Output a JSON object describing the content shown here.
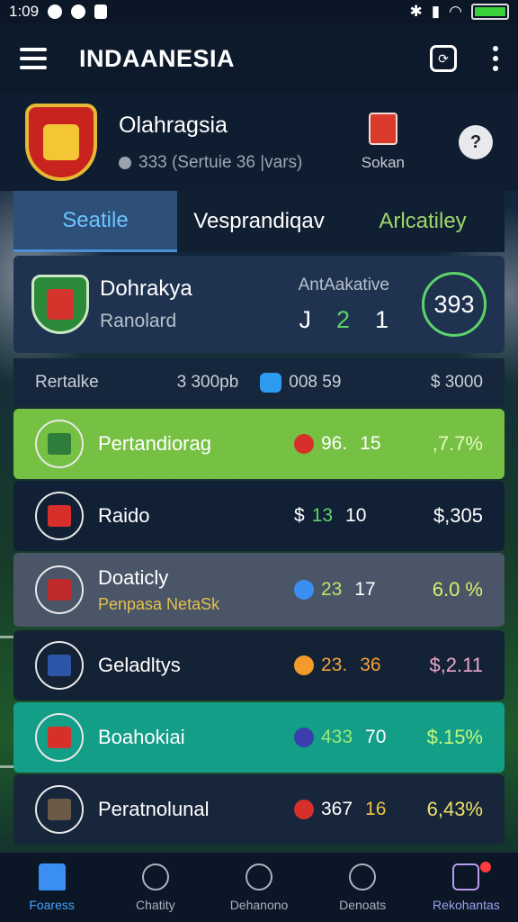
{
  "status_bar": {
    "time": "1:09",
    "icons": [
      "record-icon",
      "g-icon",
      "notification-icon",
      "bluetooth-icon",
      "signal-icon",
      "wifi-icon",
      "battery-icon"
    ]
  },
  "app_bar": {
    "title": "INDAANESIA",
    "icons": [
      "menu-icon",
      "sync-icon",
      "more-icon"
    ]
  },
  "profile": {
    "name": "Olahragsia",
    "subtitle": "333 (Sertuie 36 |vars)",
    "token_label": "Sokan",
    "help": "?"
  },
  "tabs": [
    {
      "label": "Seatile",
      "active": true
    },
    {
      "label": "Vesprandiqav",
      "active": false
    },
    {
      "label": "Arlcatiley",
      "active": false
    }
  ],
  "match": {
    "team": "Dohrakya",
    "team_sub": "Ranolard",
    "score_label": "AntAakative",
    "score_j": "J",
    "score_a": "2",
    "score_b": "1",
    "ring_value": "393"
  },
  "summary": {
    "label": "Rertalke",
    "amount": "3 300pb",
    "pill_value": "008 59",
    "total": "$ 3000"
  },
  "rows": [
    {
      "name": "Pertandiorag",
      "sub": "",
      "odd_a": "96.",
      "odd_b": "15",
      "value": ",7.7%",
      "bg": "#76c043",
      "dot": "#d7302a",
      "val_color": "#e7f9c0",
      "logo": "#2e7d3a"
    },
    {
      "name": "Raido",
      "sub": "",
      "odd_a": "$",
      "odd_b": "13",
      "odd_c": "10",
      "value": "$,305",
      "bg": "#112034",
      "dot": "",
      "val_color": "#ffffff",
      "logo": "#d7302a"
    },
    {
      "name": "Doaticly",
      "sub": "Penpasa NetaSk",
      "odd_a": "23",
      "odd_b": "17",
      "value": "6.0 %",
      "bg": "#4a5568",
      "dot": "#3b8ff2",
      "val_color": "#d7f06a",
      "logo": "#c0292a"
    },
    {
      "name": "Geladltys",
      "sub": "",
      "odd_a": "23.",
      "odd_b": "36",
      "value": "$,2.11",
      "bg": "#142235",
      "dot": "#f29b2b",
      "val_color": "#e8a6c8",
      "logo": "#2e56a8"
    },
    {
      "name": "Boahokiai",
      "sub": "",
      "odd_a": "433",
      "odd_b": "70",
      "value": "$.15%",
      "bg": "#139e88",
      "dot": "#3b3fae",
      "val_color": "#c3f77b",
      "logo": "#d7302a"
    },
    {
      "name": "Peratnolunal",
      "sub": "",
      "odd_a": "367",
      "odd_b": "16",
      "value": "6,43%",
      "bg": "#17263a",
      "dot": "#d7302a",
      "val_color": "#f0e06a",
      "logo": "#6b5a48"
    }
  ],
  "bottom_nav": [
    {
      "label": "Foaress",
      "icon": "home-icon",
      "active": true
    },
    {
      "label": "Chatity",
      "icon": "clock-icon",
      "active": false
    },
    {
      "label": "Dehanono",
      "icon": "trophy-icon",
      "active": false
    },
    {
      "label": "Denoats",
      "icon": "chart-icon",
      "active": false
    },
    {
      "label": "Rekohantas",
      "icon": "notes-icon",
      "active": false
    }
  ]
}
